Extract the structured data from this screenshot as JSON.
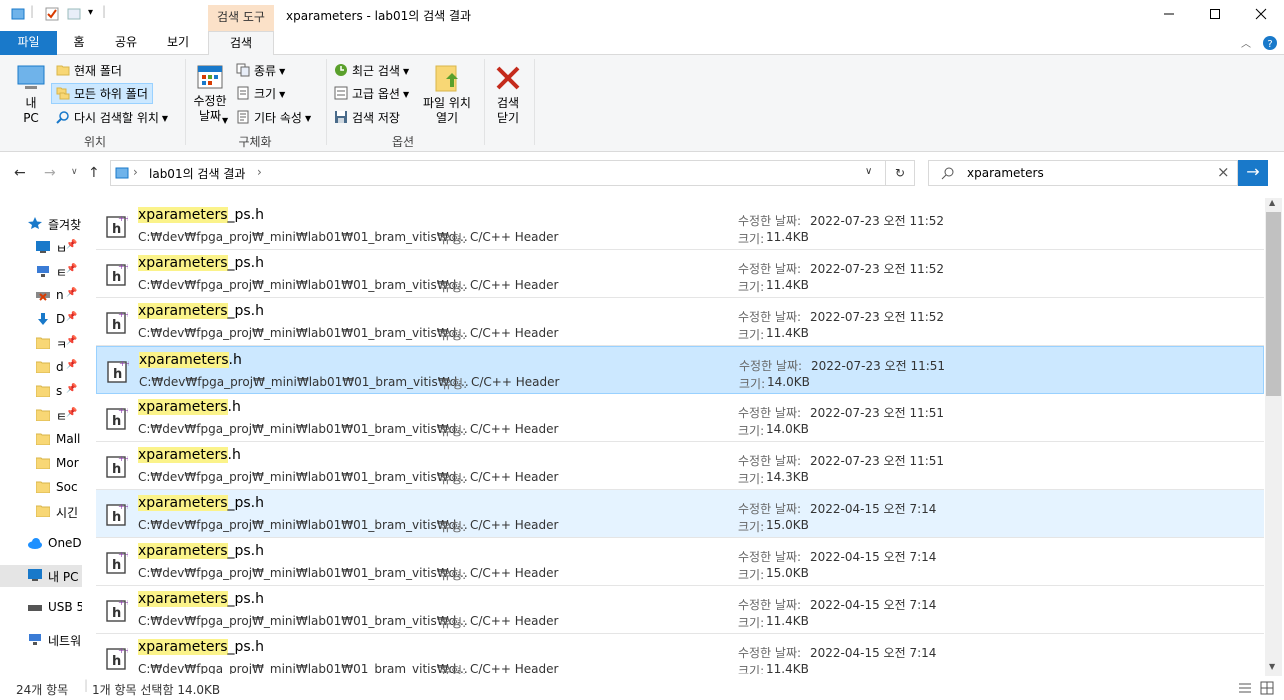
{
  "window": {
    "context_tab_header": "검색 도구",
    "title": "xparameters - lab01의 검색 결과"
  },
  "tabs": [
    {
      "label": "파일"
    },
    {
      "label": "홈"
    },
    {
      "label": "공유"
    },
    {
      "label": "보기"
    },
    {
      "label": "검색"
    }
  ],
  "ribbon": {
    "location": {
      "this_pc": "내\nPC",
      "current_folder": "현재 폴더",
      "all_subfolders": "모든 하위 폴더",
      "search_again_in": "다시 검색할 위치",
      "group_label": "위치"
    },
    "refine": {
      "date_modified": "수정한\n날짜",
      "kind": "종류",
      "size": "크기",
      "other_properties": "기타 속성",
      "group_label": "구체화"
    },
    "options": {
      "recent_searches": "최근 검색",
      "advanced_options": "고급 옵션",
      "save_search": "검색 저장",
      "open_file_location": "파일 위치\n열기",
      "group_label": "옵션"
    },
    "close": {
      "close_search": "검색\n닫기"
    }
  },
  "address": {
    "breadcrumb": "lab01의 검색 결과"
  },
  "search": {
    "query": "xparameters"
  },
  "nav_pane": [
    {
      "label": "즐겨찾",
      "icon": "star-icon",
      "color": "#1979ca"
    },
    {
      "label": "ㅂ",
      "icon": "desktop-icon",
      "color": "#1979ca"
    },
    {
      "label": "ㅌ",
      "icon": "network-icon",
      "color": "#3a7bd5"
    },
    {
      "label": "n",
      "icon": "disconnected-drive-icon",
      "color": "#d83b01"
    },
    {
      "label": "D",
      "icon": "download-icon",
      "color": "#1979ca"
    },
    {
      "label": "ㅋ",
      "icon": "folder-icon",
      "color": "#f8d775"
    },
    {
      "label": "d",
      "icon": "folder-icon",
      "color": "#f8d775"
    },
    {
      "label": "s",
      "icon": "folder-icon",
      "color": "#f8d775"
    },
    {
      "label": "ㅌ",
      "icon": "folder-icon",
      "color": "#f8d775"
    },
    {
      "label": "Mall",
      "icon": "folder-icon",
      "color": "#f8d775"
    },
    {
      "label": "Mor",
      "icon": "folder-icon",
      "color": "#f8d775"
    },
    {
      "label": "Soc",
      "icon": "folder-icon",
      "color": "#f8d775"
    },
    {
      "label": "시긴",
      "icon": "folder-icon",
      "color": "#f8d775"
    },
    {
      "label": "OneD",
      "icon": "cloud-icon",
      "color": "#1e90ff"
    },
    {
      "label": "내 PC",
      "icon": "pc-icon",
      "color": "#1979ca"
    },
    {
      "label": "USB 5",
      "icon": "usb-drive-icon",
      "color": "#555555"
    },
    {
      "label": "네트워",
      "icon": "network-icon",
      "color": "#3a7bd5"
    }
  ],
  "labels": {
    "type": "유형:",
    "date_modified": "수정한 날짜:",
    "size": "크기:"
  },
  "results": [
    {
      "name_hl": "xparameters",
      "name_rest": "_ps.h",
      "path": "C:₩dev₩fpga_proj₩_mini₩lab01₩01_bram_vitis₩d...",
      "type": "C/C++ Header",
      "date": "2022-07-23 오전 11:52",
      "size": "11.4KB",
      "state": "normal"
    },
    {
      "name_hl": "xparameters",
      "name_rest": "_ps.h",
      "path": "C:₩dev₩fpga_proj₩_mini₩lab01₩01_bram_vitis₩d...",
      "type": "C/C++ Header",
      "date": "2022-07-23 오전 11:52",
      "size": "11.4KB",
      "state": "normal"
    },
    {
      "name_hl": "xparameters",
      "name_rest": "_ps.h",
      "path": "C:₩dev₩fpga_proj₩_mini₩lab01₩01_bram_vitis₩d...",
      "type": "C/C++ Header",
      "date": "2022-07-23 오전 11:52",
      "size": "11.4KB",
      "state": "normal"
    },
    {
      "name_hl": "xparameters",
      "name_rest": ".h",
      "path": "C:₩dev₩fpga_proj₩_mini₩lab01₩01_bram_vitis₩d...",
      "type": "C/C++ Header",
      "date": "2022-07-23 오전 11:51",
      "size": "14.0KB",
      "state": "selected"
    },
    {
      "name_hl": "xparameters",
      "name_rest": ".h",
      "path": "C:₩dev₩fpga_proj₩_mini₩lab01₩01_bram_vitis₩d...",
      "type": "C/C++ Header",
      "date": "2022-07-23 오전 11:51",
      "size": "14.0KB",
      "state": "normal"
    },
    {
      "name_hl": "xparameters",
      "name_rest": ".h",
      "path": "C:₩dev₩fpga_proj₩_mini₩lab01₩01_bram_vitis₩d...",
      "type": "C/C++ Header",
      "date": "2022-07-23 오전 11:51",
      "size": "14.3KB",
      "state": "normal"
    },
    {
      "name_hl": "xparameters",
      "name_rest": "_ps.h",
      "path": "C:₩dev₩fpga_proj₩_mini₩lab01₩01_bram_vitis₩d...",
      "type": "C/C++ Header",
      "date": "2022-04-15 오전 7:14",
      "size": "15.0KB",
      "state": "hover"
    },
    {
      "name_hl": "xparameters",
      "name_rest": "_ps.h",
      "path": "C:₩dev₩fpga_proj₩_mini₩lab01₩01_bram_vitis₩d...",
      "type": "C/C++ Header",
      "date": "2022-04-15 오전 7:14",
      "size": "15.0KB",
      "state": "normal"
    },
    {
      "name_hl": "xparameters",
      "name_rest": "_ps.h",
      "path": "C:₩dev₩fpga_proj₩_mini₩lab01₩01_bram_vitis₩d...",
      "type": "C/C++ Header",
      "date": "2022-04-15 오전 7:14",
      "size": "11.4KB",
      "state": "normal"
    },
    {
      "name_hl": "xparameters",
      "name_rest": "_ps.h",
      "path": "C:₩dev₩fpga_proj₩_mini₩lab01₩01_bram_vitis₩d...",
      "type": "C/C++ Header",
      "date": "2022-04-15 오전 7:14",
      "size": "11.4KB",
      "state": "normal"
    }
  ],
  "status": {
    "item_count": "24개 항목",
    "selection": "1개 항목 선택함 14.0KB"
  },
  "colors": {
    "accent": "#1979ca",
    "highlight": "#fbf38a",
    "selected_row": "#cce8ff",
    "context_tab": "#fbe1c8"
  }
}
